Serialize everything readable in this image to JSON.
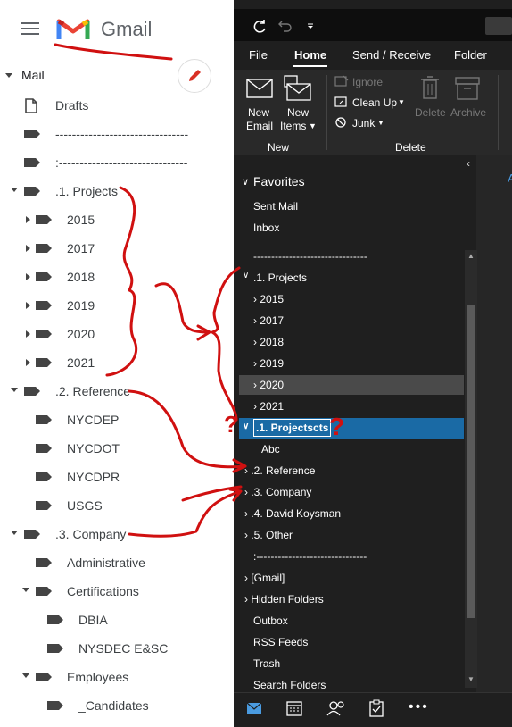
{
  "gmail": {
    "brand": "Gmail",
    "mail_label": "Mail",
    "items": [
      {
        "label": "Drafts"
      },
      {
        "label": "--------------------------------"
      },
      {
        "label": ":-------------------------------"
      },
      {
        "label": ".1. Projects"
      },
      {
        "label": "2015"
      },
      {
        "label": "2017"
      },
      {
        "label": "2018"
      },
      {
        "label": "2019"
      },
      {
        "label": "2020"
      },
      {
        "label": "2021"
      },
      {
        "label": ".2. Reference"
      },
      {
        "label": "NYCDEP"
      },
      {
        "label": "NYCDOT"
      },
      {
        "label": "NYCDPR"
      },
      {
        "label": "USGS"
      },
      {
        "label": ".3. Company"
      },
      {
        "label": "Administrative"
      },
      {
        "label": "Certifications"
      },
      {
        "label": "DBIA"
      },
      {
        "label": "NYSDEC E&SC"
      },
      {
        "label": "Employees"
      },
      {
        "label": "_Candidates"
      }
    ]
  },
  "outlook": {
    "tabs": [
      "File",
      "Home",
      "Send / Receive",
      "Folder"
    ],
    "ribbon": {
      "new_email": [
        "New",
        "Email"
      ],
      "new_items": [
        "New",
        "Items"
      ],
      "group_new": "New",
      "ignore": "Ignore",
      "clean_up": "Clean Up",
      "junk": "Junk",
      "delete": "Delete",
      "archive": "Archive",
      "group_delete": "Delete"
    },
    "favorites": {
      "title": "Favorites",
      "items": [
        "Sent Mail",
        "Inbox"
      ]
    },
    "folders": [
      "--------------------------------",
      ".1. Projects",
      "2015",
      "2017",
      "2018",
      "2019",
      "2020",
      "2021",
      ".1. Projectscts",
      "Abc",
      ".2. Reference",
      ".3. Company",
      ".4. David Koysman",
      ".5. Other",
      ":-------------------------------",
      "[Gmail]",
      "Hidden Folders",
      "Outbox",
      "RSS Feeds",
      "Trash",
      "Search Folders"
    ],
    "right_peek_letter": "A",
    "selected_color": "#1a6aa5",
    "hover_color": "#4a4a4a"
  },
  "annotation": {
    "question_mark": "?",
    "ink_color": "#d01010"
  }
}
